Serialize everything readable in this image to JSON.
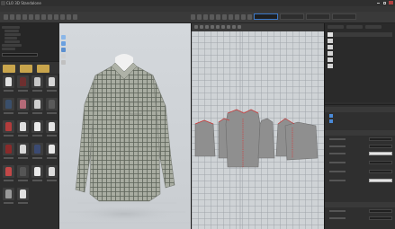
{
  "app": {
    "title": "CLO 3D Standalone",
    "theme": {
      "accent": "#3b78c8",
      "folder": "#c9a54c",
      "window_close": "#b14040"
    }
  },
  "menubar": {
    "items": [
      "",
      "",
      "",
      "",
      "",
      "",
      "",
      "",
      "",
      "",
      "",
      "",
      ""
    ]
  },
  "toolbar": {
    "left_tool_icons": [
      "cursor-icon",
      "move-icon",
      "rotate-icon",
      "fold-icon",
      "pin-icon",
      "tack-icon",
      "brush-icon",
      "measure-icon",
      "tape-icon",
      "texture-icon",
      "camera-icon",
      "render-icon"
    ],
    "tabs": [
      "",
      "",
      "",
      ""
    ],
    "active_tab": 0,
    "right_tool_icons": [
      "segment-icon",
      "point-icon",
      "line-icon",
      "rect-icon",
      "dart-icon",
      "notch-icon",
      "seam-icon",
      "sew-icon",
      "check-icon",
      "grade-icon"
    ]
  },
  "library": {
    "tree_items": [
      "",
      "",
      "",
      "",
      "",
      "",
      ""
    ],
    "path_field": "",
    "folders": [
      "",
      "",
      ""
    ],
    "thumbnails": [
      {
        "garment": "#e2e2e2"
      },
      {
        "garment": "#6e2f2f"
      },
      {
        "garment": "#c8c8c8"
      },
      {
        "garment": "#d6d6d6"
      },
      {
        "garment": "#3a4f6b"
      },
      {
        "garment": "#b46a78"
      },
      {
        "garment": "#cfcfcf"
      },
      {
        "garment": "#5a5a5a"
      },
      {
        "garment": "#b23c3c"
      },
      {
        "garment": "#e0e0e0"
      },
      {
        "garment": "#ececec"
      },
      {
        "garment": "#e4e4e4"
      },
      {
        "garment": "#8a2a2a"
      },
      {
        "garment": "#d8d8d8"
      },
      {
        "garment": "#3b4a72"
      },
      {
        "garment": "#e7e7e7"
      },
      {
        "garment": "#c24848"
      },
      {
        "garment": "#555555"
      },
      {
        "garment": "#e9e9e9"
      },
      {
        "garment": "#dcdcdc"
      },
      {
        "garment": "#9a9a9a"
      },
      {
        "garment": "#e1e1e1"
      }
    ]
  },
  "viewport_3d": {
    "garment": "plaid long-sleeve shirt on avatar",
    "fabric_color": "#a9ada2",
    "check_color": "#5c6258",
    "tool_icons": [
      "avatar-icon",
      "texture-toggle-icon",
      "camera-view-icon",
      "grid-icon",
      "light-icon"
    ]
  },
  "viewport_2d": {
    "pattern_fill": "#8f8f8f",
    "seam_color": "#d23a3a"
  },
  "object_browser": {
    "tabs": [
      "",
      "",
      ""
    ],
    "items": [
      {
        "label": "",
        "swatch": "#e3e3e3"
      },
      {
        "label": "",
        "swatch": "#d5d5d5"
      },
      {
        "label": "",
        "swatch": "#d5d5d5"
      },
      {
        "label": "",
        "swatch": "#d5d5d5"
      },
      {
        "label": "",
        "swatch": "#d5d5d5"
      },
      {
        "label": "",
        "swatch": "#d5d5d5"
      }
    ]
  },
  "property_editor": {
    "sections": [
      "",
      "",
      ""
    ],
    "rows": [
      "",
      "",
      "",
      "",
      "",
      "",
      "",
      "",
      "",
      ""
    ]
  }
}
